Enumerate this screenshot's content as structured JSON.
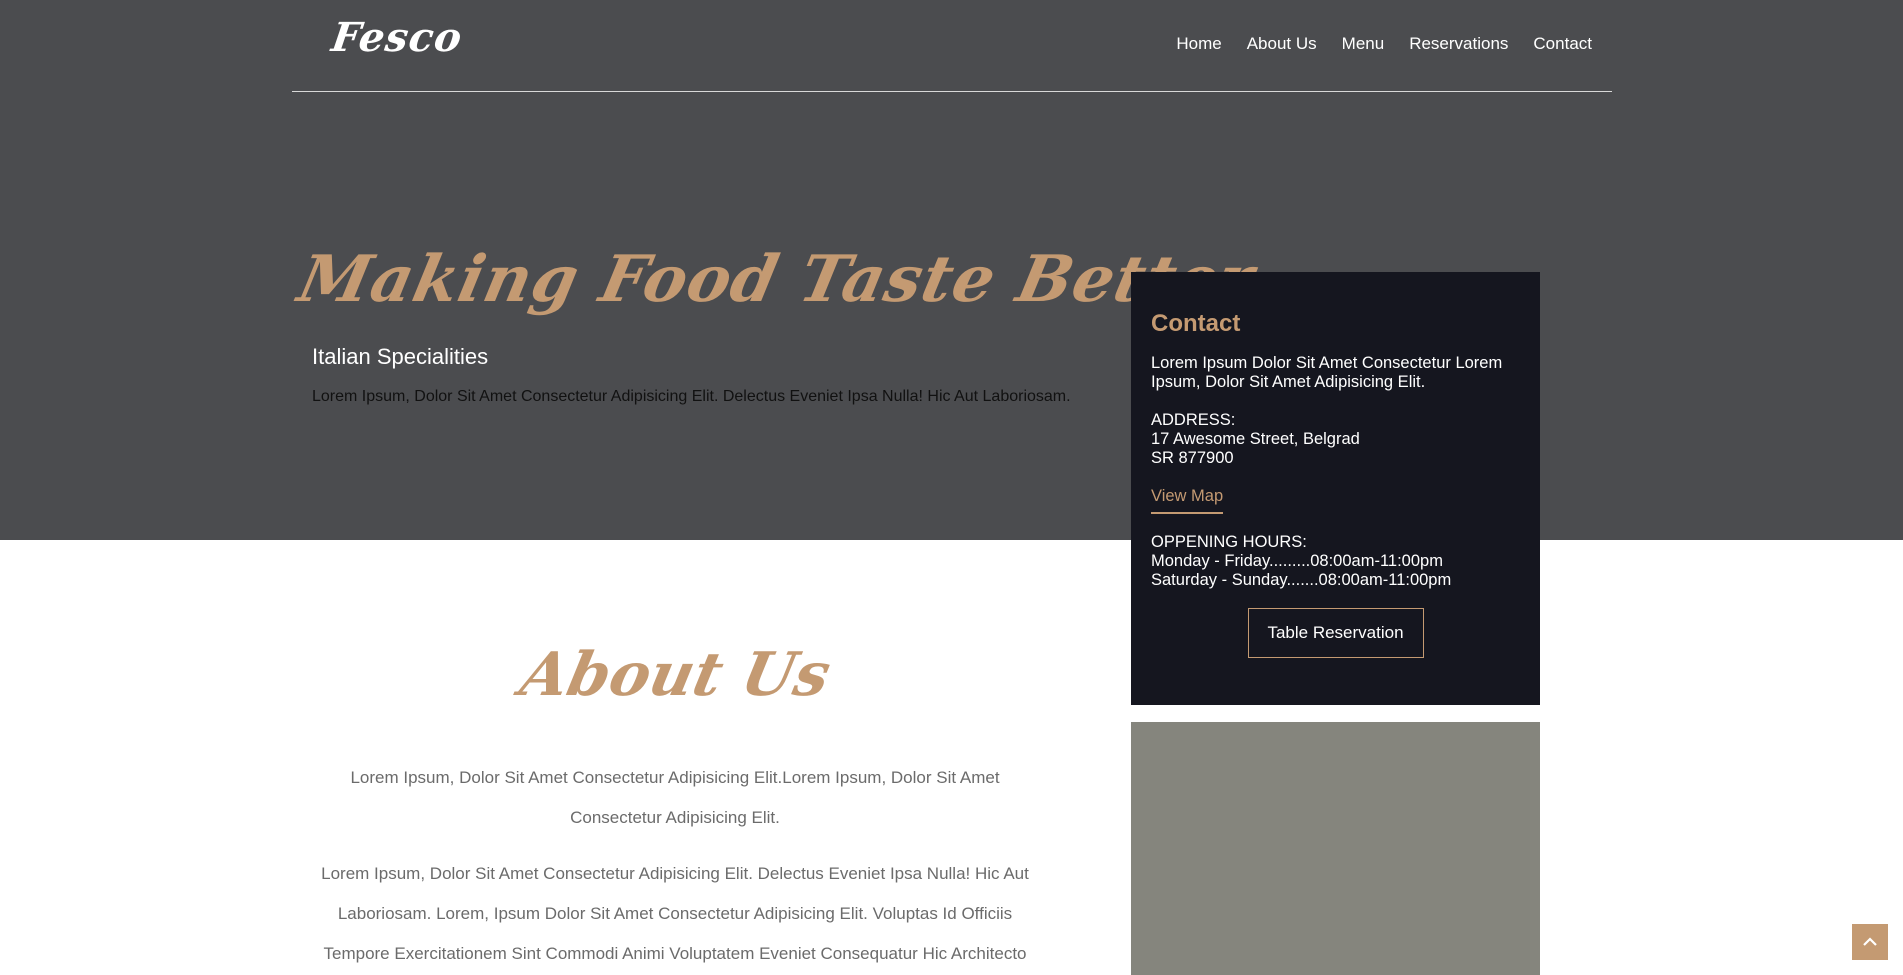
{
  "header": {
    "logo": "Fesco",
    "nav": [
      "Home",
      "About Us",
      "Menu",
      "Reservations",
      "Contact"
    ]
  },
  "hero": {
    "title": "Making Food Taste Better",
    "subtitle": "Italian Specialities",
    "description": "Lorem Ipsum, Dolor Sit Amet Consectetur Adipisicing Elit. Delectus Eveniet Ipsa Nulla! Hic Aut Laboriosam."
  },
  "contact": {
    "title": "Contact",
    "intro": "Lorem Ipsum Dolor Sit Amet Consectetur Lorem Ipsum, Dolor Sit Amet Adipisicing Elit.",
    "address_label": "ADDRESS:",
    "address_line1": "17 Awesome Street, Belgrad",
    "address_line2": "SR 877900",
    "view_map": "View Map",
    "hours_label": "OPPENING HOURS:",
    "hours_weekday": "Monday - Friday.........08:00am-11:00pm",
    "hours_weekend": "Saturday - Sunday.......08:00am-11:00pm",
    "button": "Table Reservation"
  },
  "about": {
    "title": "About Us",
    "p1": "Lorem Ipsum, Dolor Sit Amet Consectetur Adipisicing Elit.Lorem Ipsum, Dolor Sit Amet Consectetur Adipisicing Elit.",
    "p2": "Lorem Ipsum, Dolor Sit Amet Consectetur Adipisicing Elit. Delectus Eveniet Ipsa Nulla! Hic Aut Laboriosam. Lorem, Ipsum Dolor Sit Amet Consectetur Adipisicing Elit. Voluptas Id Officiis Tempore Exercitationem Sint Commodi Animi Voluptatem Eveniet Consequatur Hic Architecto"
  },
  "scroll_top": {
    "icon": "chevron-up-icon"
  },
  "colors": {
    "hero_bg": "#4b4c4f",
    "accent": "#c49a72",
    "card_bg": "#15161f",
    "map_bg": "#85857d"
  }
}
